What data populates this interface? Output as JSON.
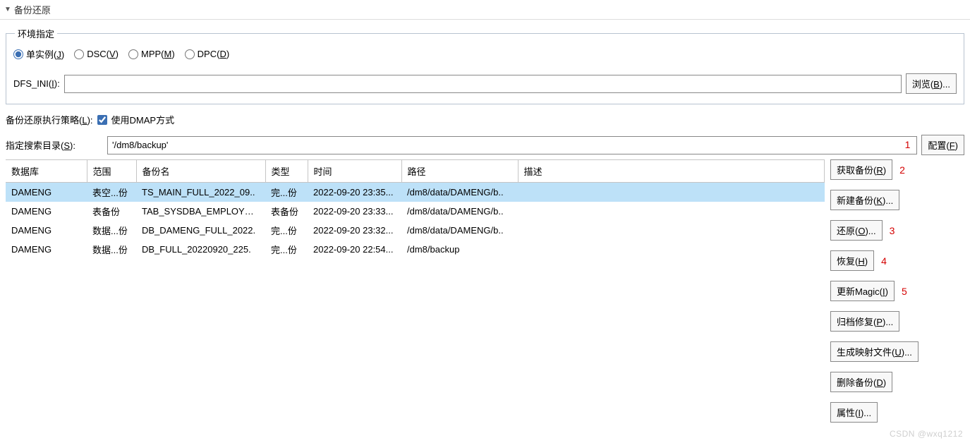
{
  "panel": {
    "title": "备份还原"
  },
  "env": {
    "legend": "环境指定",
    "single_base": "单实例(",
    "single_key": "J",
    "dsc_base": "DSC(",
    "dsc_key": "V",
    "mpp_base": "MPP(",
    "mpp_key": "M",
    "dpc_base": "DPC(",
    "dpc_key": "D",
    "close_paren": ")",
    "dfs_label_base": "DFS_INI(",
    "dfs_key": "I",
    "dfs_label_end": "):",
    "dfs_value": "",
    "browse_base": "浏览(",
    "browse_key": "B",
    "browse_end": ")..."
  },
  "policy": {
    "label_base": "备份还原执行策略(",
    "label_key": "L",
    "label_end": "):",
    "check_label": "使用DMAP方式",
    "checked": true
  },
  "search": {
    "label_base": "指定搜索目录(",
    "label_key": "S",
    "label_end": "):",
    "value": "'/dm8/backup'",
    "config_base": "配置(",
    "config_key": "F",
    "config_end": ")",
    "annot": "1"
  },
  "table": {
    "headers": {
      "db": "数据库",
      "scope": "范围",
      "name": "备份名",
      "type": "类型",
      "time": "时间",
      "path": "路径",
      "desc": "描述"
    },
    "rows": [
      {
        "db": "DAMENG",
        "scope": "表空...份",
        "name": "TS_MAIN_FULL_2022_09..",
        "type": "完...份",
        "time": "2022-09-20 23:35...",
        "path": "/dm8/data/DAMENG/b..",
        "desc": "",
        "selected": true
      },
      {
        "db": "DAMENG",
        "scope": "表备份",
        "name": "TAB_SYSDBA_EMPLOYEE_",
        "type": "表备份",
        "time": "2022-09-20 23:33...",
        "path": "/dm8/data/DAMENG/b..",
        "desc": "",
        "selected": false
      },
      {
        "db": "DAMENG",
        "scope": "数据...份",
        "name": "DB_DAMENG_FULL_2022.",
        "type": "完...份",
        "time": "2022-09-20 23:32...",
        "path": "/dm8/data/DAMENG/b..",
        "desc": "",
        "selected": false
      },
      {
        "db": "DAMENG",
        "scope": "数据...份",
        "name": "DB_FULL_20220920_225.",
        "type": "完...份",
        "time": "2022-09-20 22:54...",
        "path": "/dm8/backup",
        "desc": "",
        "selected": false
      }
    ]
  },
  "side": {
    "get_base": "获取备份(",
    "get_key": "R",
    "get_end": ")",
    "get_annot": "2",
    "new_base": "新建备份(",
    "new_key": "K",
    "new_end": ")...",
    "restore_base": "还原(",
    "restore_key": "O",
    "restore_end": ")...",
    "restore_annot": "3",
    "recover_base": "恢复(",
    "recover_key": "H",
    "recover_end": ")",
    "recover_annot": "4",
    "magic_base": "更新Magic(",
    "magic_key": "I",
    "magic_end": ")",
    "magic_annot": "5",
    "archive_base": "归档修复(",
    "archive_key": "P",
    "archive_end": ")...",
    "map_base": "生成映射文件(",
    "map_key": "U",
    "map_end": ")...",
    "delete_base": "删除备份(",
    "delete_key": "D",
    "delete_end": ")",
    "prop_base": "属性(",
    "prop_key": "I",
    "prop_end": ")..."
  },
  "watermark": "CSDN @wxq1212"
}
